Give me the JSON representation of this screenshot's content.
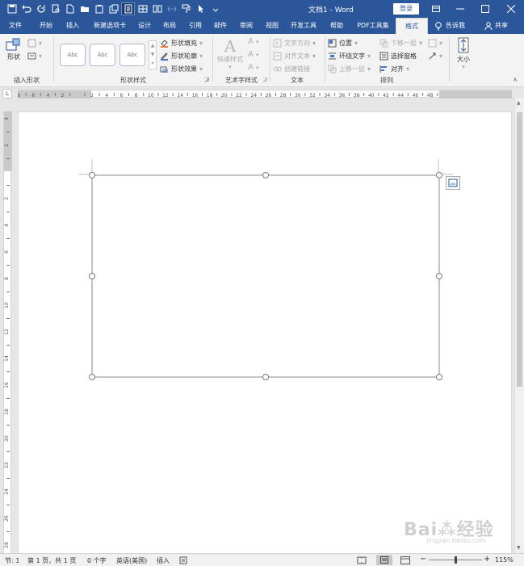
{
  "title": {
    "doc_title": "文档1 - Word",
    "login_label": "登录"
  },
  "qat_icons": [
    "save-icon",
    "undo-icon",
    "redo-icon",
    "print-preview-icon",
    "new-icon",
    "open-icon",
    "paste-special-icon",
    "save-as-icon",
    "read-mode-icon",
    "draw-table-icon",
    "columns-icon",
    "page-break-icon",
    "format-painter-icon",
    "select-icon",
    "customize-icon"
  ],
  "tabs": [
    "文件",
    "开始",
    "插入",
    "新建选项卡",
    "设计",
    "布局",
    "引用",
    "邮件",
    "审阅",
    "视图",
    "开发工具",
    "帮助",
    "PDF工具集",
    "格式"
  ],
  "active_tab": "格式",
  "tell_me": "告诉我",
  "share": "共享",
  "ribbon": {
    "insert_shape": {
      "shape_label": "形状",
      "group": "插入形状"
    },
    "shape_styles": {
      "abc": [
        "Abc",
        "Abc",
        "Abc"
      ],
      "fill": "形状填充",
      "outline": "形状轮廓",
      "effects": "形状效果",
      "group": "形状样式"
    },
    "wordart": {
      "quick": "快速样式",
      "group": "艺术字样式"
    },
    "text": {
      "direction": "文字方向",
      "align": "对齐文本",
      "link": "创建链接",
      "group": "文本"
    },
    "arrange": {
      "position": "位置",
      "wrap": "环绕文字",
      "forward": "上移一层",
      "backward": "下移一层",
      "pane": "选择窗格",
      "align": "对齐",
      "group": "排列"
    },
    "size": {
      "label": "大小"
    }
  },
  "ruler": {
    "corner": "L",
    "h_labels": [
      "8",
      "6",
      "4",
      "2",
      "",
      "2",
      "4",
      "6",
      "8",
      "10",
      "12",
      "14",
      "16",
      "18",
      "20",
      "22",
      "24",
      "26",
      "28",
      "30",
      "32",
      "34",
      "36",
      "38",
      "40",
      "42",
      "44",
      "46",
      "48"
    ],
    "v_labels": [
      "4",
      "2",
      "",
      "2",
      "4",
      "6",
      "8",
      "10",
      "12",
      "14",
      "16",
      "18",
      "20",
      "22",
      "24",
      "26",
      "28"
    ]
  },
  "status": {
    "section": "节: 1",
    "page": "第 1 页，共 1 页",
    "words": "0 个字",
    "lang": "英语(美国)",
    "mode": "插入",
    "zoom": "115%"
  },
  "watermark": {
    "text": "Bai 经验",
    "url": "jingyan.baidu.com"
  },
  "colors": {
    "accent": "#2b579a",
    "handle": "#7a7a7a"
  }
}
